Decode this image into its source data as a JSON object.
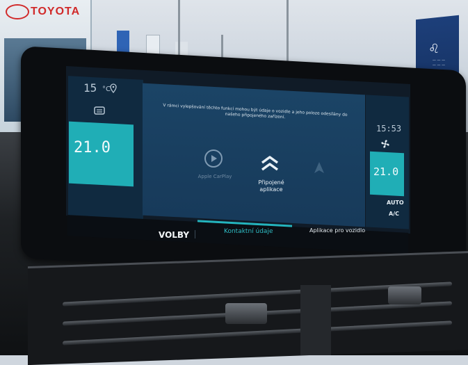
{
  "scene": {
    "dealer_sign": "TOYOTA"
  },
  "screen": {
    "outside_temp": "15",
    "outside_temp_unit": "°C",
    "clock": "15:53",
    "driver_temp": "21.0",
    "passenger_temp": "21.0",
    "auto_label": "AUTO",
    "ac_label": "A/C",
    "notice": "V rámci vylepšování těchto funkcí mohou být údaje o vozidle a jeho poloze odesílány do našeho připojeného zařízení.",
    "apps": {
      "carplay_label": "Apple CarPlay",
      "connected_label": "Připojené aplikace"
    },
    "bottom_bar": {
      "options_label": "VOLBY",
      "tab_contact": "Kontaktní údaje",
      "tab_apps": "Aplikace pro vozidlo"
    }
  },
  "colors": {
    "accent_teal": "#20aeb6",
    "screen_blue": "#1b4466",
    "toyota_red": "#d12a2a",
    "peugeot_blue": "#1d3f7a"
  }
}
